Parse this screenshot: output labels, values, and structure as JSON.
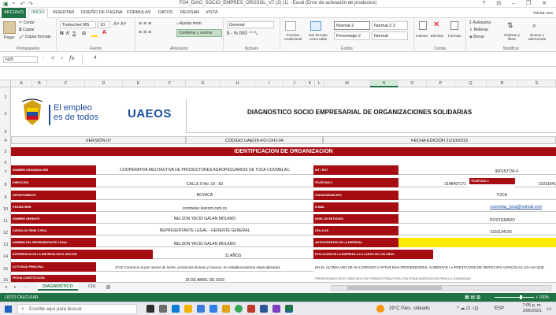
{
  "window": {
    "title": "FO4_DIAG_SOCIO_EMPRES_ORGSOL_V7 (2) (1) - Excel (Error de activación de productos)",
    "controls": "?  ⊟  –  ❐  ✕"
  },
  "menu": {
    "file": "ARCHIVO",
    "tabs": [
      "INICIO",
      "INSERTAR",
      "DISEÑO DE PÁGINA",
      "FÓRMULAS",
      "DATOS",
      "REVISAR",
      "VISTA"
    ],
    "signin": "Iniciar ses"
  },
  "ribbon": {
    "clipboard": {
      "cut": "Cortar",
      "copy": "Copiar",
      "paste": "Pegar",
      "format_painter": "Copiar formato",
      "label": "Portapapeles"
    },
    "font": {
      "name": "Trebuchet MS",
      "size": "10",
      "label": "Fuente"
    },
    "alignment": {
      "wrap": "Ajustar texto",
      "merge": "Combinar y centrar",
      "label": "Alineación"
    },
    "number": {
      "format": "General",
      "symbols": "$ - % 000 ⁺⁰ ⁰₀",
      "label": "Número"
    },
    "styles": {
      "conditional": "Formato condicional",
      "as_table": "Dar formato como tabla",
      "cells": [
        "Normal 2",
        "Normal 2 2",
        "Porcentaje 2",
        "Normal"
      ],
      "label": "Estilos"
    },
    "cells": {
      "insert": "Insertar",
      "delete": "Eliminar",
      "format": "Formato",
      "label": "Celdas"
    },
    "editing": {
      "autosum": "Autosuma",
      "fill": "Rellenar",
      "clear": "Borrar",
      "sort": "Ordenar y filtrar",
      "find": "Buscar y seleccionar",
      "label": "Modificar"
    }
  },
  "formula_bar": {
    "name_box": "N25",
    "fx": "fx",
    "content": "4"
  },
  "columns": [
    "A",
    "B",
    "C",
    "D",
    "E",
    "F",
    "G",
    "H",
    "I",
    "J",
    "K",
    "L",
    "M",
    "N",
    "O",
    "P",
    "Q",
    "R",
    "S"
  ],
  "rows": [
    "1",
    "2",
    "3",
    "4",
    "5",
    "6",
    "7",
    "8",
    "9",
    "10",
    "11",
    "12",
    "13",
    "14",
    "15",
    "16",
    "17"
  ],
  "selected_column": "N",
  "sheet": {
    "logo": {
      "line1": "El empleo",
      "line2": "es de todos",
      "brand": "UAEOS"
    },
    "title": "DIAGNOSTICO SOCIO EMPRESARIAL DE ORGANIZACIONES SOLIDARIAS",
    "version": "VERSIÓN 07",
    "code": "CÓDIGO UAEOS-FO-CFO-04",
    "edition_date": "FECHA EDICIÓN 21/10/2019",
    "section": "IDENTIFICACION DE ORGANIZACION",
    "left_labels": [
      "NOMBRE ORGANIZACIÓN",
      "DIRECCIÓN",
      "DEPARTAMENTO",
      "PÁGINA WEB",
      "NOMBRE GERENTE",
      "CARGO (SI TIENE OTRO)",
      "NOMBRE DEL REPRESENTANTE LEGAL",
      "EXPERIENCIA DE LA EMPRESA EN EL SECTOR",
      "ACTIVIDAD PRINCIPAL",
      "FECHA CONSTITUCIÓN"
    ],
    "left_values": [
      "COOPERATIVA MULTIACTIVA DE PRODUCTORES AGROPECUARIOS DE TOCA COOMELAC",
      "CALLE 8 No. 10 - 83",
      "BOYACÁ",
      "coomelac.lexcom.com.co",
      "NELSON YECID GALAN MOLANO",
      "REPRESENTANTE LEGAL - GERENTE GENERAL",
      "NELSON YECID GALAN MOLANO",
      "11 AÑOS",
      "4722 Comercio al por menor de leche, productos lácteos y huevos, en establecimientos especializados",
      "18 DE ABRIL DE 2010"
    ],
    "right_labels": [
      "NIT / RUT",
      "TELÉFONO 1",
      "CIUDAD/MUNICIPIO",
      "E-MAIL",
      "NIVEL DE ESTUDIOS",
      "CELULAR",
      "ANTECEDENTES DE LA EMPRESA",
      "EVOLUCIÓN DE LA EMPRESA A LO LARGO DE LOS AÑOS"
    ],
    "right_values": {
      "nit": "900152734-4",
      "phone1": "3148497171",
      "phone2_label": "TELÉFONO 2",
      "phone2": "31031941",
      "city": "TOCA",
      "email": "coomelac_toca@hotmail.com",
      "education": "POSTGRADO",
      "mobile": "3103194155"
    },
    "evolution_text": "EN EL ÚLTIMO AÑO SE HA LOGRADO CAPTAR MAS PROVEEDORES, AUMENTAR LA PRESTACION DE SERVICIOS AGRICOLAS, ES ASI QUE",
    "evolution_text2": "PRESENTANDO EN EL MERCADO EN FORMA EXTRAÇTORA CON ETIAM AGREGACIÓN PARA LA COMUNIDAD"
  },
  "sheet_tabs": [
    "DIAGNOSTICO",
    "CIU"
  ],
  "status": {
    "left": "LISTO   CALCULAR",
    "zoom": "+ 100%"
  },
  "taskbar": {
    "search": "Escribe aquí para buscar",
    "weather": "29°C  Parc. soleado",
    "time": "7:05 p. m.",
    "date": "1/06/2021",
    "lang": "ESP"
  },
  "colors": {
    "accent": "#217346",
    "red": "#a50d12",
    "logo_blue": "#1c4c9c"
  }
}
